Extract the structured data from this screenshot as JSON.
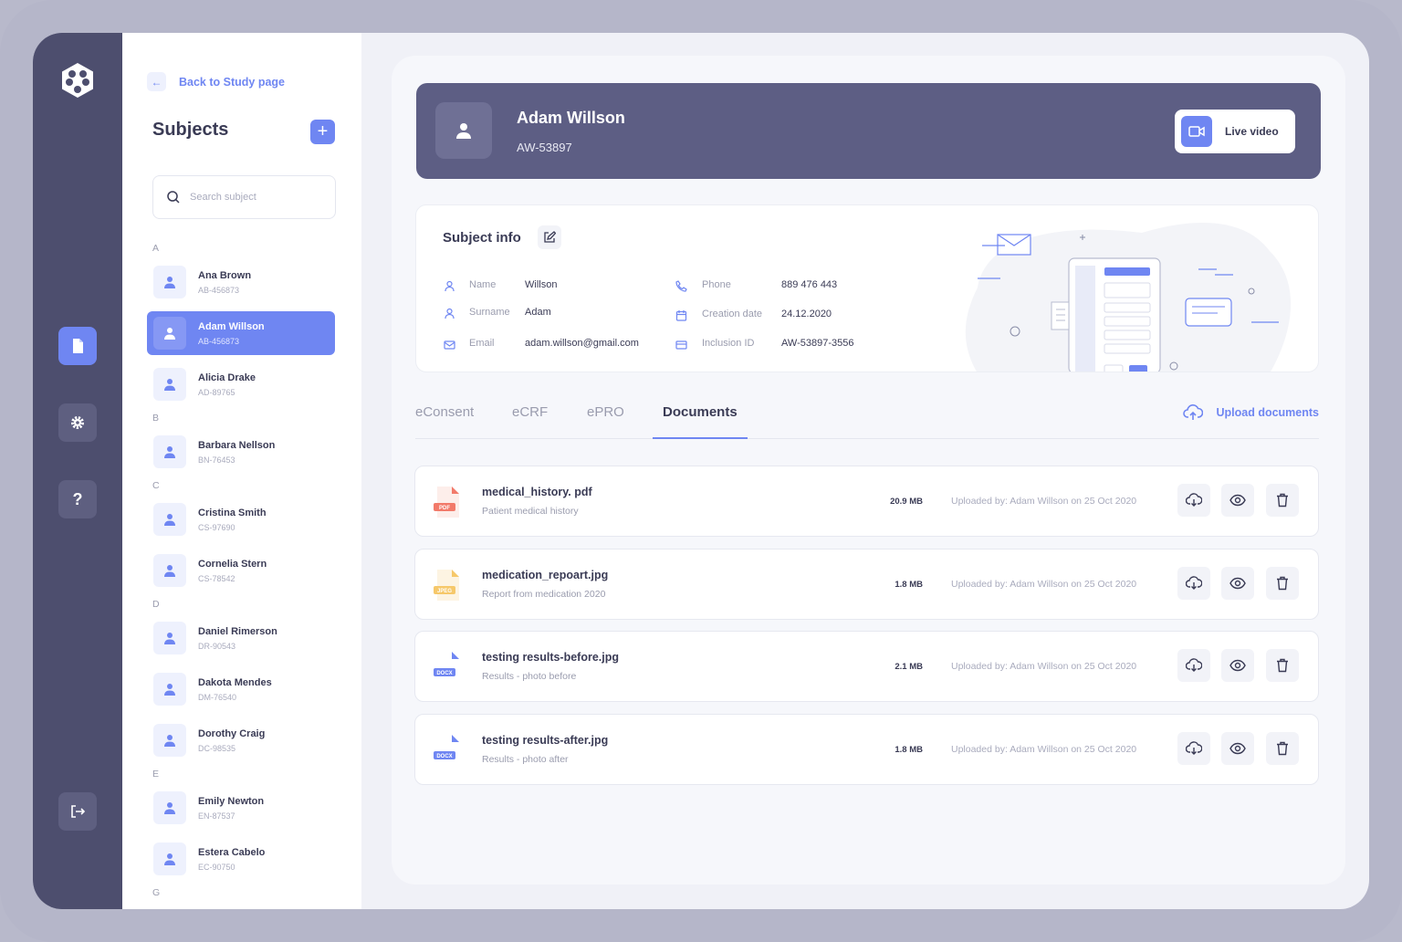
{
  "colors": {
    "accent": "#6f86f2",
    "rail": "#4d4e6e",
    "header": "#5d5e84",
    "text": "#3a3b55",
    "muted": "#9a9cae",
    "pdf": "#f27a6a",
    "jpeg": "#f6c86a",
    "docx": "#6f86f2"
  },
  "rail": {
    "logo": "logo-icon",
    "items": [
      {
        "name": "document-icon",
        "active": true
      },
      {
        "name": "gear-icon",
        "active": false
      },
      {
        "name": "help-icon",
        "label": "?",
        "active": false
      },
      {
        "name": "logout-icon",
        "active": false
      }
    ]
  },
  "subjects": {
    "back_label": "Back to Study page",
    "title": "Subjects",
    "add_label": "+",
    "search_placeholder": "Search subject",
    "groups": [
      {
        "letter": "A",
        "items": [
          {
            "name": "Ana Brown",
            "code": "AB-456873",
            "active": false
          },
          {
            "name": "Adam Willson",
            "code": "AB-456873",
            "active": true
          },
          {
            "name": "Alicia Drake",
            "code": "AD-89765",
            "active": false
          }
        ]
      },
      {
        "letter": "B",
        "items": [
          {
            "name": "Barbara Nellson",
            "code": "BN-76453",
            "active": false
          }
        ]
      },
      {
        "letter": "C",
        "items": [
          {
            "name": "Cristina Smith",
            "code": "CS-97690",
            "active": false
          },
          {
            "name": "Cornelia Stern",
            "code": "CS-78542",
            "active": false
          }
        ]
      },
      {
        "letter": "D",
        "items": [
          {
            "name": "Daniel Rimerson",
            "code": "DR-90543",
            "active": false
          },
          {
            "name": "Dakota Mendes",
            "code": "DM-76540",
            "active": false
          },
          {
            "name": "Dorothy Craig",
            "code": "DC-98535",
            "active": false
          }
        ]
      },
      {
        "letter": "E",
        "items": [
          {
            "name": "Emily Newton",
            "code": "EN-87537",
            "active": false
          },
          {
            "name": "Estera Cabelo",
            "code": "EC-90750",
            "active": false
          }
        ]
      },
      {
        "letter": "G",
        "items": []
      }
    ]
  },
  "header": {
    "name": "Adam Willson",
    "code": "AW-53897",
    "live_label": "Live video"
  },
  "subject_info": {
    "title": "Subject info",
    "fields": [
      {
        "key": "Name",
        "value": "Willson",
        "icon": "user-icon"
      },
      {
        "key": "Surname",
        "value": "Adam",
        "icon": "user-icon"
      },
      {
        "key": "Email",
        "value": "adam.willson@gmail.com",
        "icon": "mail-icon"
      },
      {
        "key": "Phone",
        "value": "889 476 443",
        "icon": "phone-icon"
      },
      {
        "key": "Creation date",
        "value": "24.12.2020",
        "icon": "calendar-icon"
      },
      {
        "key": "Inclusion ID",
        "value": "AW-53897-3556",
        "icon": "card-icon"
      }
    ]
  },
  "tabs": {
    "items": [
      "eConsent",
      "eCRF",
      "ePRO",
      "Documents"
    ],
    "active": "Documents",
    "upload_label": "Upload documents"
  },
  "documents": [
    {
      "name": "medical_history. pdf",
      "desc": "Patient medical history",
      "size": "20.9 MB",
      "type": "PDF",
      "uploaded_prefix": "Uploaded by: ",
      "uploaded_by": "Adam Willson",
      "uploaded_mid": " on ",
      "uploaded_on": "25 Oct 2020"
    },
    {
      "name": "medication_repoart.jpg",
      "desc": "Report from medication 2020",
      "size": "1.8 MB",
      "type": "JPEG",
      "uploaded_prefix": "Uploaded by: ",
      "uploaded_by": "Adam Willson",
      "uploaded_mid": " on ",
      "uploaded_on": "25 Oct 2020"
    },
    {
      "name": "testing results-before.jpg",
      "desc": "Results - photo before",
      "size": "2.1 MB",
      "type": "DOCX",
      "uploaded_prefix": "Uploaded by: ",
      "uploaded_by": "Adam Willson",
      "uploaded_mid": " on ",
      "uploaded_on": "25 Oct 2020"
    },
    {
      "name": "testing results-after.jpg",
      "desc": "Results - photo after",
      "size": "1.8 MB",
      "type": "DOCX",
      "uploaded_prefix": "Uploaded by: ",
      "uploaded_by": "Adam Willson",
      "uploaded_mid": " on ",
      "uploaded_on": "25 Oct 2020"
    }
  ],
  "document_actions": [
    "download-icon",
    "eye-icon",
    "trash-icon"
  ]
}
